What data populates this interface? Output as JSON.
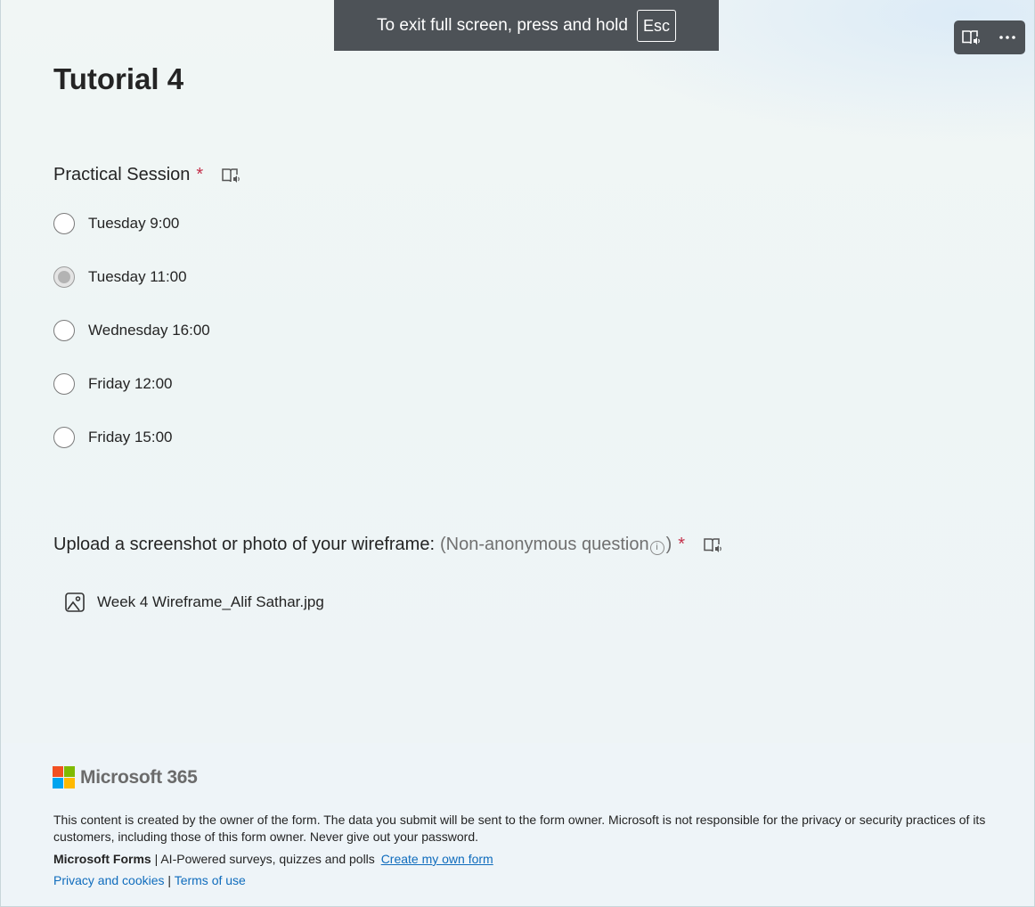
{
  "fullscreen_banner": {
    "message": "To exit full screen, press and hold",
    "key": "Esc"
  },
  "toolbar": {
    "reader_icon": "immersive-reader-icon",
    "more_icon": "more-options-icon"
  },
  "form": {
    "title": "Tutorial 4"
  },
  "question1": {
    "title": "Practical Session",
    "required_mark": "*",
    "options": [
      {
        "label": "Tuesday 9:00",
        "selected": false
      },
      {
        "label": "Tuesday 11:00",
        "selected": true
      },
      {
        "label": "Wednesday 16:00",
        "selected": false
      },
      {
        "label": "Friday 12:00",
        "selected": false
      },
      {
        "label": "Friday 15:00",
        "selected": false
      }
    ]
  },
  "question2": {
    "title": "Upload a screenshot or photo of your wireframe:",
    "note_open": "(Non-anonymous question",
    "info_glyph": "i",
    "note_close": ")",
    "required_mark": "*",
    "file_name": "Week 4 Wireframe_Alif Sathar.jpg"
  },
  "footer": {
    "brand": "Microsoft 365",
    "disclaimer": "This content is created by the owner of the form. The data you submit will be sent to the form owner. Microsoft is not responsible for the privacy or security practices of its customers, including those of this form owner. Never give out your password.",
    "forms_name": "Microsoft Forms",
    "separator": "|",
    "forms_tagline": "AI-Powered surveys, quizzes and polls",
    "create_link": "Create my own form",
    "privacy_link": "Privacy and cookies",
    "terms_link": "Terms of use"
  },
  "colors": {
    "required": "#c4314b",
    "link": "#0f6cbd",
    "banner_bg": "#4d5257",
    "ms_red": "#f25022",
    "ms_green": "#7fba00",
    "ms_blue": "#00a4ef",
    "ms_yellow": "#ffb900"
  }
}
